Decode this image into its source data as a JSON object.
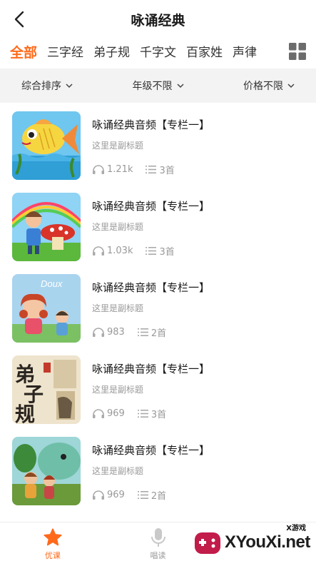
{
  "header": {
    "title": "咏诵经典"
  },
  "tabs": [
    "全部",
    "三字经",
    "弟子规",
    "千字文",
    "百家姓",
    "声律"
  ],
  "filters": {
    "sort": "综合排序",
    "grade": "年级不限",
    "price": "价格不限"
  },
  "items": [
    {
      "title": "咏诵经典音频【专栏一】",
      "subtitle": "这里是副标题",
      "plays": "1.21k",
      "tracks": "3首"
    },
    {
      "title": "咏诵经典音频【专栏一】",
      "subtitle": "这里是副标题",
      "plays": "1.03k",
      "tracks": "3首"
    },
    {
      "title": "咏诵经典音频【专栏一】",
      "subtitle": "这里是副标题",
      "plays": "983",
      "tracks": "2首"
    },
    {
      "title": "咏诵经典音频【专栏一】",
      "subtitle": "这里是副标题",
      "plays": "969",
      "tracks": "3首"
    },
    {
      "title": "咏诵经典音频【专栏一】",
      "subtitle": "这里是副标题",
      "plays": "969",
      "tracks": "2首"
    }
  ],
  "covers": {
    "third_text": "Doux",
    "fourth_text": "弟子规"
  },
  "bottom_nav": [
    {
      "label": "优课",
      "icon": "star-icon",
      "active": true
    },
    {
      "label": "唱读",
      "icon": "microphone-icon",
      "active": false
    }
  ],
  "watermark": {
    "brand": "XYouXi.net",
    "small": "X游戏"
  },
  "colors": {
    "accent": "#ff6a1a",
    "muted": "#999999",
    "filter_bg": "#f3f3f3"
  }
}
